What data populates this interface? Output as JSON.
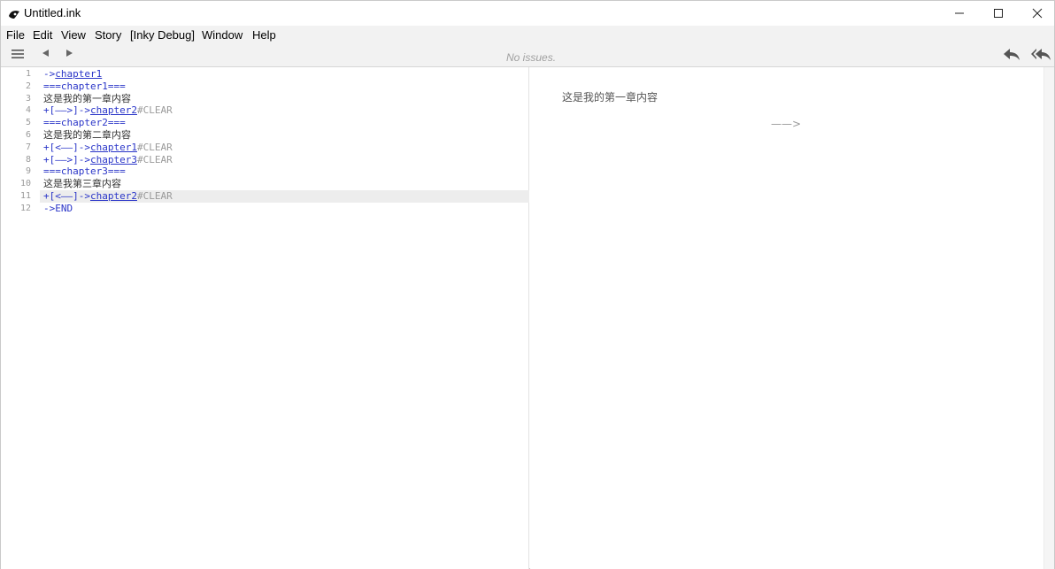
{
  "window": {
    "title": "Untitled.ink"
  },
  "menu": [
    "File",
    "Edit",
    "View",
    "Story",
    "[Inky Debug]",
    "Window",
    "Help"
  ],
  "toolbar": {
    "status": "No issues."
  },
  "icons": {
    "app": "ink-logo-icon",
    "minimize": "minimize-icon",
    "maximize": "maximize-icon",
    "close": "close-icon",
    "menu": "hamburger-menu-icon",
    "back": "triangle-left-icon",
    "forward": "triangle-right-icon",
    "undo": "reply-icon",
    "restart": "reply-all-icon"
  },
  "editor": {
    "active_line": 11,
    "lines": [
      {
        "n": "1",
        "tokens": [
          {
            "t": "->",
            "c": "c-blue"
          },
          {
            "t": "chapter1",
            "c": "c-link"
          }
        ]
      },
      {
        "n": "2",
        "tokens": [
          {
            "t": "===chapter1===",
            "c": "c-blue"
          }
        ]
      },
      {
        "n": "3",
        "tokens": [
          {
            "t": "这是我的第一章内容",
            "c": "c-text"
          }
        ]
      },
      {
        "n": "4",
        "tokens": [
          {
            "t": "+[——>]->",
            "c": "c-blue"
          },
          {
            "t": "chapter2",
            "c": "c-link"
          },
          {
            "t": "#CLEAR",
            "c": "c-gray"
          }
        ]
      },
      {
        "n": "5",
        "tokens": [
          {
            "t": "===chapter2===",
            "c": "c-blue"
          }
        ]
      },
      {
        "n": "6",
        "tokens": [
          {
            "t": "这是我的第二章内容",
            "c": "c-text"
          }
        ]
      },
      {
        "n": "7",
        "tokens": [
          {
            "t": "+[<——]->",
            "c": "c-blue"
          },
          {
            "t": "chapter1",
            "c": "c-link"
          },
          {
            "t": "#CLEAR",
            "c": "c-gray"
          }
        ]
      },
      {
        "n": "8",
        "tokens": [
          {
            "t": "+[——>]->",
            "c": "c-blue"
          },
          {
            "t": "chapter3",
            "c": "c-link"
          },
          {
            "t": "#CLEAR",
            "c": "c-gray"
          }
        ]
      },
      {
        "n": "9",
        "tokens": [
          {
            "t": "===chapter3===",
            "c": "c-blue"
          }
        ]
      },
      {
        "n": "10",
        "tokens": [
          {
            "t": "这是我第三章内容",
            "c": "c-text"
          }
        ]
      },
      {
        "n": "11",
        "tokens": [
          {
            "t": "+[<——]->",
            "c": "c-blue"
          },
          {
            "t": "chapter2",
            "c": "c-link"
          },
          {
            "t": "#CLEAR",
            "c": "c-gray"
          }
        ]
      },
      {
        "n": "12",
        "tokens": [
          {
            "t": "->END",
            "c": "c-blue"
          }
        ]
      }
    ]
  },
  "preview": {
    "text": "这是我的第一章内容",
    "choice": "——>"
  },
  "colors": {
    "keyword": "#2a35c8",
    "tag": "#9a9a9a",
    "toolbar_bg": "#f2f2f2"
  }
}
